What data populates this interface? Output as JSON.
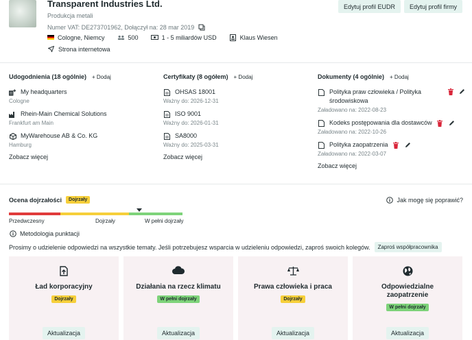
{
  "company": {
    "name": "Transparent Industries Ltd.",
    "industry": "Produkcja metali",
    "vat_line": "Numer VAT: DE273701962, Dołączył na: 28 mar 2019",
    "location": "Cologne, Niemcy",
    "employees": "500",
    "revenue": "1 - 5 miliardów USD",
    "contact": "Klaus Wiesen",
    "website": "Strona internetowa"
  },
  "actions": {
    "edit_eudr": "Edytuj profil EUDR",
    "edit_company": "Edytuj profil firmy"
  },
  "locations": {
    "header": "Udogodnienia (18 ogólnie)",
    "add": "+ Dodaj",
    "items": [
      {
        "title": "My headquarters",
        "sub": "Cologne",
        "icon": "headquarters-icon"
      },
      {
        "title": "Rhein-Main Chemical Solutions",
        "sub": "Frankfurt am Main",
        "icon": "factory-icon"
      },
      {
        "title": "MyWarehouse AB & Co. KG",
        "sub": "Hamburg",
        "icon": "warehouse-icon"
      }
    ],
    "see_more": "Zobacz więcej"
  },
  "certificates": {
    "header": "Certyfikaty (8 ogółem)",
    "add": "+ Dodaj",
    "items": [
      {
        "title": "OHSAS 18001",
        "sub": "Ważny do: 2026-12-31"
      },
      {
        "title": "ISO 9001",
        "sub": "Ważny do: 2026-01-31"
      },
      {
        "title": "SA8000",
        "sub": "Ważny do: 2025-03-31"
      }
    ],
    "see_more": "Zobacz więcej"
  },
  "documents": {
    "header": "Dokumenty (4 ogólnie)",
    "add": "+ Dodaj",
    "items": [
      {
        "title_line1": "Polityka praw człowieka / Polityka",
        "title_line2": "środowiskowa",
        "sub": "Załadowano na: 2022-08-23"
      },
      {
        "title_line1": "Kodeks postępowania dla dostawców",
        "title_line2": "",
        "sub": "Załadowano na: 2022-10-26"
      },
      {
        "title_line1": "Polityka zaopatrzenia",
        "title_line2": "",
        "sub": "Załadowano na: 2022-03-07"
      }
    ],
    "see_more": "Zobacz więcej"
  },
  "maturity": {
    "label": "Ocena dojrzałości",
    "badge": "Dojrzały",
    "help": "Jak mogę się poprawić?",
    "scale_labels": [
      "Przedwczesny",
      "Dojrzały",
      "W pełni dojrzały"
    ],
    "colors": {
      "low": "#e03b3b",
      "mid": "#f6cf3a",
      "high": "#7ed37a"
    },
    "methodology": "Metodologia punktacji",
    "invite_text": "Prosimy o udzielenie odpowiedzi na wszystkie tematy. Jeśli potrzebujesz wsparcia w udzieleniu odpowiedzi, zaproś swoich kolegów.",
    "invite_button": "Zaproś współpracownika"
  },
  "topics": [
    {
      "title": "Ład korporacyjny",
      "badge": "Dojrzały",
      "badge_color": "yellow",
      "icon": "upload-document-icon",
      "button": "Aktualizacja"
    },
    {
      "title": "Działania na rzecz klimatu",
      "badge": "W pełni dojrzały",
      "badge_color": "green",
      "icon": "cloud-icon",
      "button": "Aktualizacja"
    },
    {
      "title": "Prawa człowieka i praca",
      "badge": "Dojrzały",
      "badge_color": "yellow",
      "icon": "scales-icon",
      "button": "Aktualizacja"
    },
    {
      "title_line1": "Odpowiedzialne",
      "title_line2": "zaopatrzenie",
      "badge": "W pełni dojrzały",
      "badge_color": "green",
      "icon": "globe-icon",
      "button": "Aktualizacja"
    }
  ]
}
